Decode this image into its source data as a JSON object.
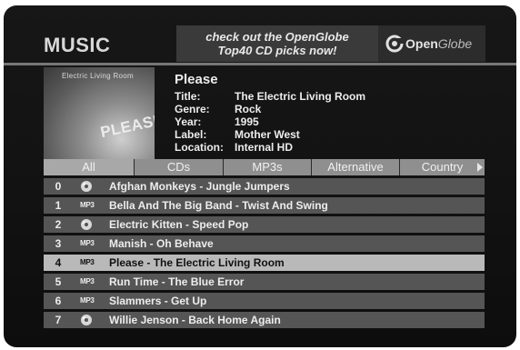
{
  "header": {
    "title": "MUSIC"
  },
  "promo": {
    "line1": "check out the OpenGlobe",
    "line2": "Top40 CD picks now!"
  },
  "logo": {
    "text_open": "Open",
    "text_globe": "Globe",
    "icon": "openglobe-logo-icon"
  },
  "album": {
    "cover_band_text": "Electric Living Room",
    "cover_title_text": "PLEASE",
    "heading": "Please",
    "fields": [
      {
        "label": "Title:",
        "value": "The Electric Living Room"
      },
      {
        "label": "Genre:",
        "value": "Rock"
      },
      {
        "label": "Year:",
        "value": "1995"
      },
      {
        "label": "Label:",
        "value": "Mother West"
      },
      {
        "label": "Location:",
        "value": "Internal HD"
      }
    ]
  },
  "tabs": [
    {
      "label": "All",
      "active": true
    },
    {
      "label": "CDs",
      "active": false
    },
    {
      "label": "MP3s",
      "active": false
    },
    {
      "label": "Alternative",
      "active": false
    },
    {
      "label": "Country",
      "active": false
    }
  ],
  "tracks": [
    {
      "num": "0",
      "type": "cd",
      "type_label": "",
      "text": "Afghan Monkeys - Jungle Jumpers"
    },
    {
      "num": "1",
      "type": "mp3",
      "type_label": "MP3",
      "text": "Bella And The Big Band - Twist And Swing"
    },
    {
      "num": "2",
      "type": "cd",
      "type_label": "",
      "text": "Electric Kitten - Speed Pop"
    },
    {
      "num": "3",
      "type": "mp3",
      "type_label": "MP3",
      "text": "Manish - Oh Behave"
    },
    {
      "num": "4",
      "type": "mp3",
      "type_label": "MP3",
      "text": "Please - The Electric Living Room",
      "selected": true
    },
    {
      "num": "5",
      "type": "mp3",
      "type_label": "MP3",
      "text": "Run Time - The Blue Error"
    },
    {
      "num": "6",
      "type": "mp3",
      "type_label": "MP3",
      "text": "Slammers - Get Up"
    },
    {
      "num": "7",
      "type": "cd",
      "type_label": "",
      "text": "Willie Jenson - Back Home Again"
    }
  ],
  "colors": {
    "background": "#141414",
    "row": "#555555",
    "row_selected": "#b9b9b9",
    "tabbar": "#8f8f8f"
  }
}
